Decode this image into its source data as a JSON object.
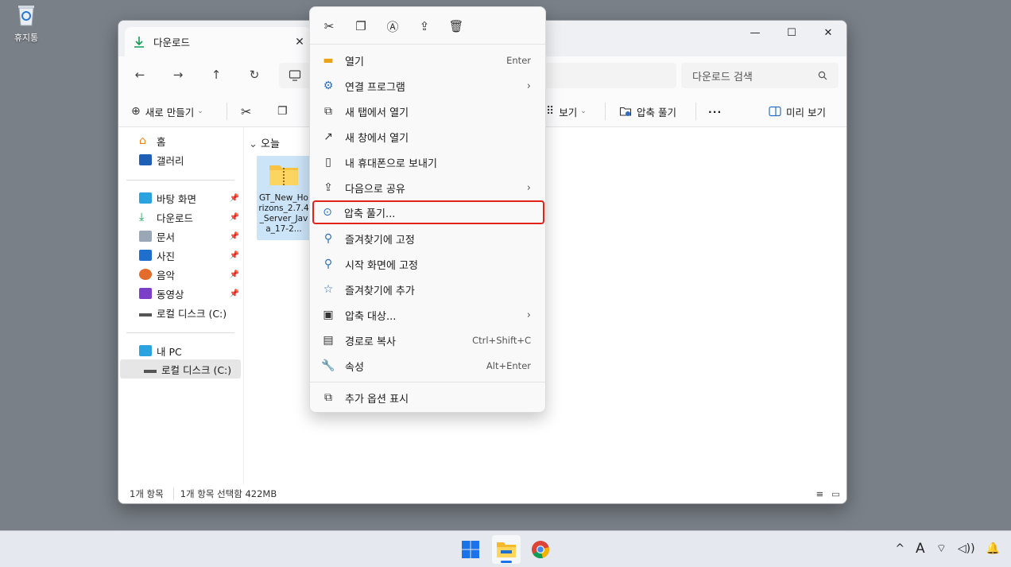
{
  "desktop": {
    "recycle_bin_label": "휴지통"
  },
  "window": {
    "tab_title": "다운로드",
    "tab_close": "✕",
    "controls": {
      "minimize": "—",
      "maximize": "☐",
      "close": "✕"
    }
  },
  "nav": {
    "back": "←",
    "forward": "→",
    "up": "↑",
    "refresh": "↻",
    "search_placeholder": "다운로드 검색",
    "search_icon": "search-icon"
  },
  "commands": {
    "new_label": "새로 만들기",
    "view_label": "보기",
    "extract_label": "압축 풀기",
    "more_label": "···",
    "preview_label": "미리 보기"
  },
  "sidebar": {
    "items": [
      {
        "label": "홈",
        "icon": "home-icon"
      },
      {
        "label": "갤러리",
        "icon": "gallery-icon"
      },
      {
        "label": "바탕 화면",
        "icon": "desktop-icon",
        "pinned": true
      },
      {
        "label": "다운로드",
        "icon": "download-icon",
        "pinned": true
      },
      {
        "label": "문서",
        "icon": "document-icon",
        "pinned": true
      },
      {
        "label": "사진",
        "icon": "pictures-icon",
        "pinned": true
      },
      {
        "label": "음악",
        "icon": "music-icon",
        "pinned": true
      },
      {
        "label": "동영상",
        "icon": "video-icon",
        "pinned": true
      },
      {
        "label": "로컬 디스크 (C:)",
        "icon": "drive-icon"
      },
      {
        "label": "내 PC",
        "icon": "pc-icon"
      },
      {
        "label": "로컬 디스크 (C:)",
        "icon": "drive-icon"
      }
    ]
  },
  "main": {
    "group_header": "오늘",
    "file_name": "GT_New_Horizons_2.7.4_Server_Java_17-2..."
  },
  "status": {
    "count": "1개 항목",
    "selection": "1개 항목 선택함 422MB"
  },
  "context_menu": {
    "quick_actions": [
      "cut-icon",
      "copy-icon",
      "rename-icon",
      "share-icon",
      "delete-icon"
    ],
    "items": [
      {
        "label": "열기",
        "shortcut": "Enter",
        "icon": "folder-open-icon"
      },
      {
        "label": "연결 프로그램",
        "submenu": true,
        "icon": "open-with-icon"
      },
      {
        "label": "새 탭에서 열기",
        "icon": "new-tab-icon"
      },
      {
        "label": "새 창에서 열기",
        "icon": "new-window-icon"
      },
      {
        "label": "내 휴대폰으로 보내기",
        "icon": "phone-icon"
      },
      {
        "label": "다음으로 공유",
        "submenu": true,
        "icon": "share-icon"
      },
      {
        "label": "압축 풀기...",
        "icon": "extract-icon",
        "highlighted": true
      },
      {
        "label": "즐겨찾기에 고정",
        "icon": "pin-icon"
      },
      {
        "label": "시작 화면에 고정",
        "icon": "pin-start-icon"
      },
      {
        "label": "즐겨찾기에 추가",
        "icon": "star-icon"
      },
      {
        "label": "압축 대상...",
        "submenu": true,
        "icon": "compress-icon"
      },
      {
        "label": "경로로 복사",
        "shortcut": "Ctrl+Shift+C",
        "icon": "copy-path-icon"
      },
      {
        "label": "속성",
        "shortcut": "Alt+Enter",
        "icon": "properties-icon"
      },
      {
        "label": "추가 옵션 표시",
        "icon": "more-options-icon"
      }
    ],
    "submenu_arrow": "›"
  },
  "taskbar": {
    "apps": [
      "start-icon",
      "file-explorer-icon",
      "chrome-icon"
    ],
    "tray": {
      "chevron": "^",
      "ime": "A",
      "volume": "🔊"
    }
  },
  "colors": {
    "highlight_border": "#e2231a",
    "selection_bg": "#cce4f7",
    "accent": "#1a73e8"
  }
}
